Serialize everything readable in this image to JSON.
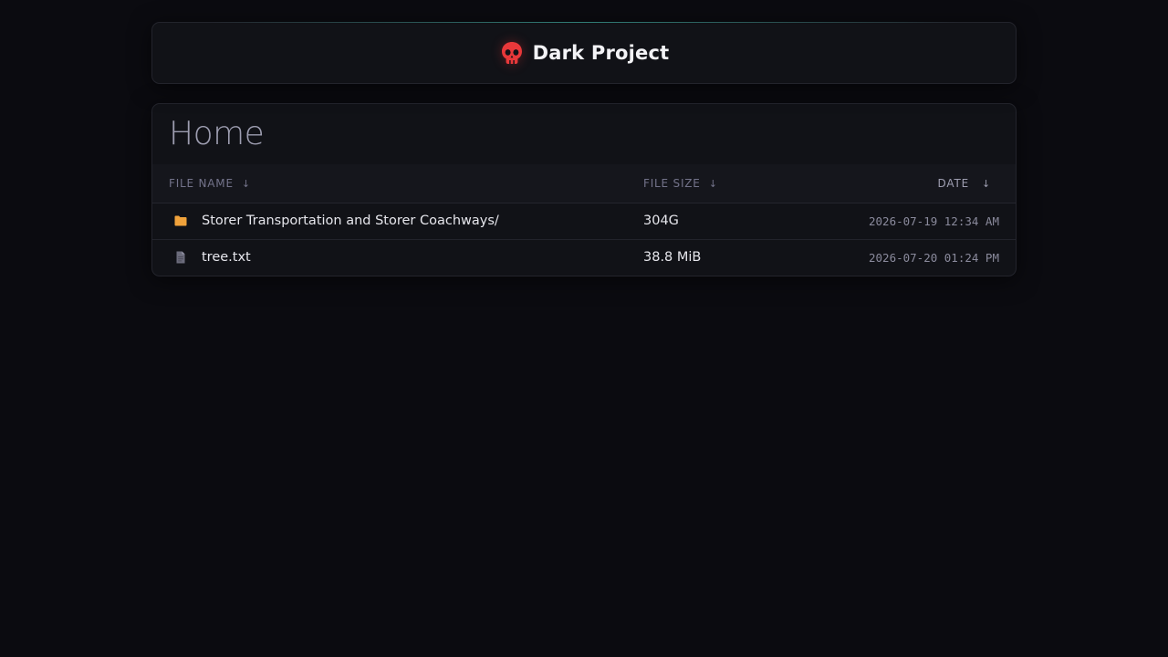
{
  "header": {
    "logo_icon": "skull-icon",
    "title": "Dark Project",
    "accent_color": "#e8383a"
  },
  "page": {
    "title": "Home"
  },
  "table": {
    "columns": {
      "name": "FILE NAME",
      "size": "FILE SIZE",
      "date": "DATE",
      "sort_glyph": "↓"
    },
    "rows": [
      {
        "icon": "folder-icon",
        "icon_color": "#f0a23b",
        "name": "Storer Transportation and Storer Coachways/",
        "size": "304G",
        "date": "2026-07-19 12:34 AM"
      },
      {
        "icon": "file-icon",
        "icon_color": "#6c6c7c",
        "name": "tree.txt",
        "size": "38.8 MiB",
        "date": "2026-07-20 01:24 PM"
      }
    ]
  }
}
